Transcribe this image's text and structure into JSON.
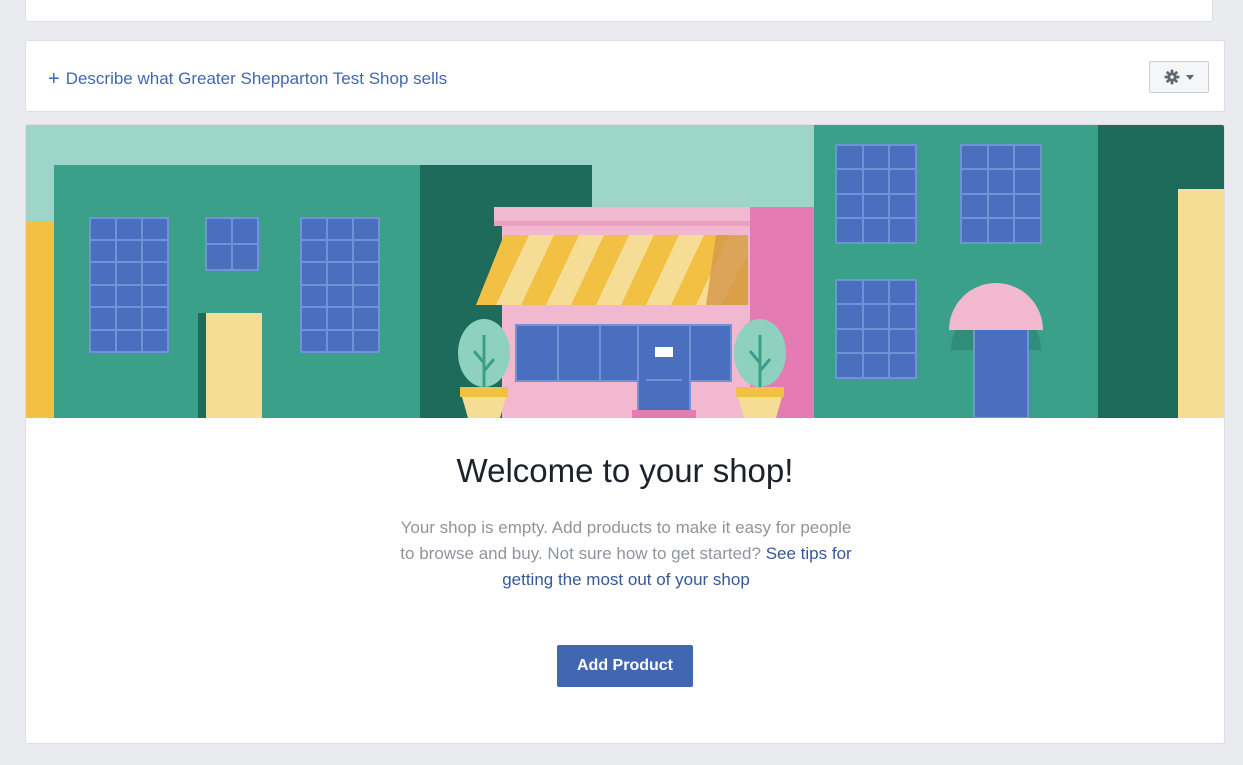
{
  "colors": {
    "page_bg": "#e9ebee",
    "link": "#4267b2",
    "primary_button": "#4267b2",
    "sky": "#9dd5c8",
    "building_teal": "#3ba08a",
    "building_dark": "#1e6b5c",
    "window_blue": "#4a6fbf",
    "shop_pink": "#f2b8d0",
    "awning_yellow": "#f2c043",
    "door_yellow": "#f6dd95"
  },
  "describe_bar": {
    "icon": "plus-icon",
    "plus_symbol": "+",
    "label": "Describe what Greater Shepparton Test Shop sells",
    "settings_icon": "gear-icon",
    "dropdown_icon": "caret-down-icon"
  },
  "banner": {
    "icon": "storefront-illustration"
  },
  "welcome": {
    "title": "Welcome to your shop!",
    "body": "Your shop is empty. Add products to make it easy for people to browse and buy. Not sure how to get started? ",
    "tips_link": "See tips for getting the most out of your shop",
    "add_product_label": "Add Product"
  }
}
